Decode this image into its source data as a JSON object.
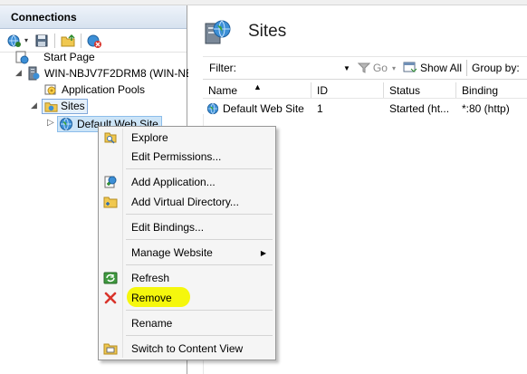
{
  "connections": {
    "title": "Connections",
    "tree": {
      "start_page": "Start Page",
      "server": "WIN-NBJV7F2DRM8 (WIN-NB",
      "app_pools": "Application Pools",
      "sites": "Sites",
      "default_site": "Default Web Site"
    }
  },
  "main": {
    "title": "Sites",
    "filter": {
      "label": "Filter:",
      "go": "Go",
      "show_all": "Show All",
      "group_by": "Group by:"
    },
    "columns": [
      "Name",
      "ID",
      "Status",
      "Binding"
    ],
    "rows": [
      {
        "name": "Default Web Site",
        "id": "1",
        "status": "Started (ht...",
        "binding": "*:80 (http)"
      }
    ]
  },
  "context_menu": {
    "explore": "Explore",
    "edit_permissions": "Edit Permissions...",
    "add_application": "Add Application...",
    "add_virtual_directory": "Add Virtual Directory...",
    "edit_bindings": "Edit Bindings...",
    "manage_website": "Manage Website",
    "refresh": "Refresh",
    "remove": "Remove",
    "rename": "Rename",
    "switch_content_view": "Switch to Content View",
    "highlight_color": "#f4f700"
  }
}
